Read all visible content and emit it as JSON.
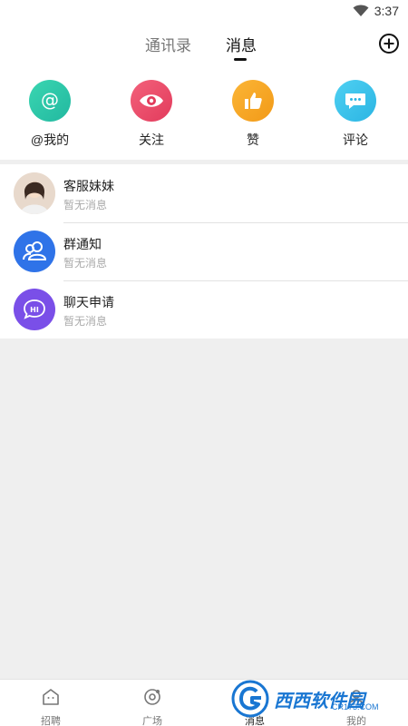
{
  "status_bar": {
    "time": "3:37"
  },
  "header": {
    "tabs": [
      {
        "label": "通讯录",
        "active": false
      },
      {
        "label": "消息",
        "active": true
      }
    ],
    "add_icon": "circle-plus-icon"
  },
  "quick_actions": [
    {
      "label": "@我的",
      "icon": "at-icon",
      "color": "#2fcaa8"
    },
    {
      "label": "关注",
      "icon": "eye-icon",
      "color": "#ee4d6a"
    },
    {
      "label": "赞",
      "icon": "thumbs-up-icon",
      "color": "#f7a824"
    },
    {
      "label": "评论",
      "icon": "chat-bubble-icon",
      "color": "#3bc3ec"
    }
  ],
  "messages": [
    {
      "title": "客服妹妹",
      "subtitle": "暂无消息",
      "avatar": "person-photo"
    },
    {
      "title": "群通知",
      "subtitle": "暂无消息",
      "avatar": "group-icon",
      "color": "#2f73e8"
    },
    {
      "title": "聊天申请",
      "subtitle": "暂无消息",
      "avatar": "hi-bubble-icon",
      "color": "#7a4fe8"
    }
  ],
  "bottom_nav": [
    {
      "label": "招聘",
      "icon": "home-icon"
    },
    {
      "label": "广场",
      "icon": "orbit-icon"
    },
    {
      "label": "消息",
      "icon": "message-icon"
    },
    {
      "label": "我的",
      "icon": "profile-icon"
    }
  ],
  "watermark": {
    "text": "西西软件园",
    "sub": "CR173.COM"
  }
}
